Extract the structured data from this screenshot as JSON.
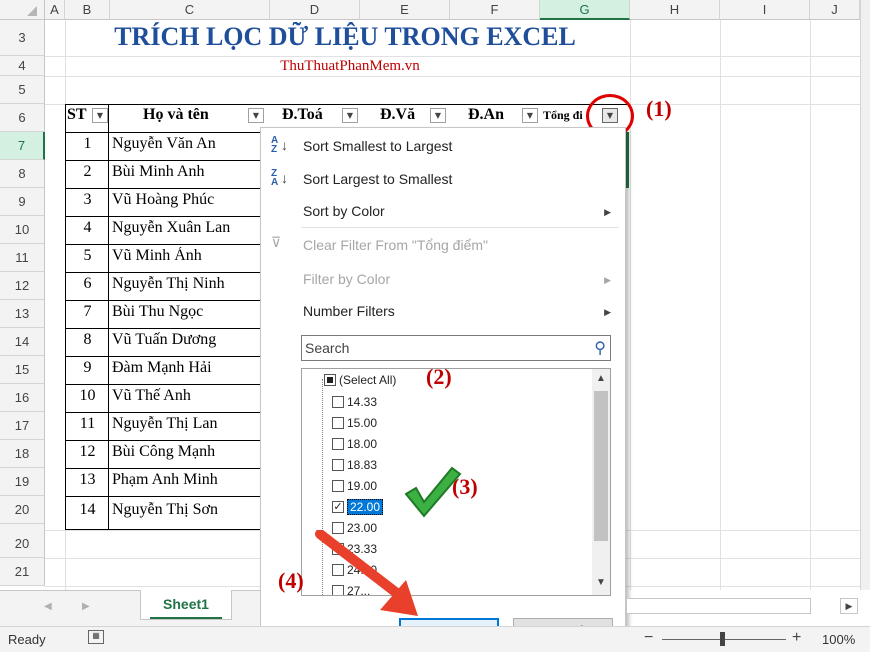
{
  "columns": [
    "A",
    "B",
    "C",
    "D",
    "E",
    "F",
    "G",
    "H",
    "I",
    "J"
  ],
  "rows": [
    "3",
    "4",
    "5",
    "6",
    "7",
    "8",
    "9",
    "10",
    "11",
    "12",
    "13",
    "14",
    "15",
    "16",
    "17",
    "18",
    "19",
    "20",
    "21"
  ],
  "title": "TRÍCH LỌC DỮ LIỆU TRONG EXCEL",
  "subtitle": "ThuThuatPhanMem.vn",
  "headers": {
    "stt": "ST",
    "name": "Họ và tên",
    "toan": "Đ.Toá",
    "van": "Đ.Vă",
    "anh": "Đ.An",
    "tong": "Tổng đi"
  },
  "students": [
    {
      "no": "1",
      "name": "Nguyễn Văn An"
    },
    {
      "no": "2",
      "name": "Bùi Minh Anh"
    },
    {
      "no": "3",
      "name": "Vũ Hoàng Phúc"
    },
    {
      "no": "4",
      "name": "Nguyễn Xuân Lan"
    },
    {
      "no": "5",
      "name": "Vũ Minh Ánh"
    },
    {
      "no": "6",
      "name": "Nguyễn Thị Ninh"
    },
    {
      "no": "7",
      "name": "Bùi Thu Ngọc"
    },
    {
      "no": "8",
      "name": "Vũ Tuấn Dương"
    },
    {
      "no": "9",
      "name": "Đàm Mạnh Hải"
    },
    {
      "no": "10",
      "name": "Vũ Thế Anh"
    },
    {
      "no": "11",
      "name": "Nguyễn Thị Lan"
    },
    {
      "no": "12",
      "name": "Bùi Công Mạnh"
    },
    {
      "no": "13",
      "name": "Phạm Anh Minh"
    },
    {
      "no": "14",
      "name": "Nguyễn Thị Sơn"
    }
  ],
  "menu": {
    "sort_asc": "Sort Smallest to Largest",
    "sort_desc": "Sort Largest to Smallest",
    "sort_color": "Sort by Color",
    "clear_filter": "Clear Filter From \"Tổng điểm\"",
    "filter_color": "Filter by Color",
    "number_filters": "Number Filters",
    "search_placeholder": "Search",
    "select_all": "(Select All)",
    "values": [
      "14.33",
      "15.00",
      "18.00",
      "18.83",
      "19.00",
      "22.00",
      "23.00",
      "23.33",
      "24.00",
      "27..."
    ],
    "ok": "OK",
    "cancel": "Cancel"
  },
  "annotations": {
    "a1": "(1)",
    "a2": "(2)",
    "a3": "(3)",
    "a4": "(4)"
  },
  "sheet_tab": "Sheet1",
  "status": {
    "ready": "Ready",
    "zoom": "100%"
  }
}
